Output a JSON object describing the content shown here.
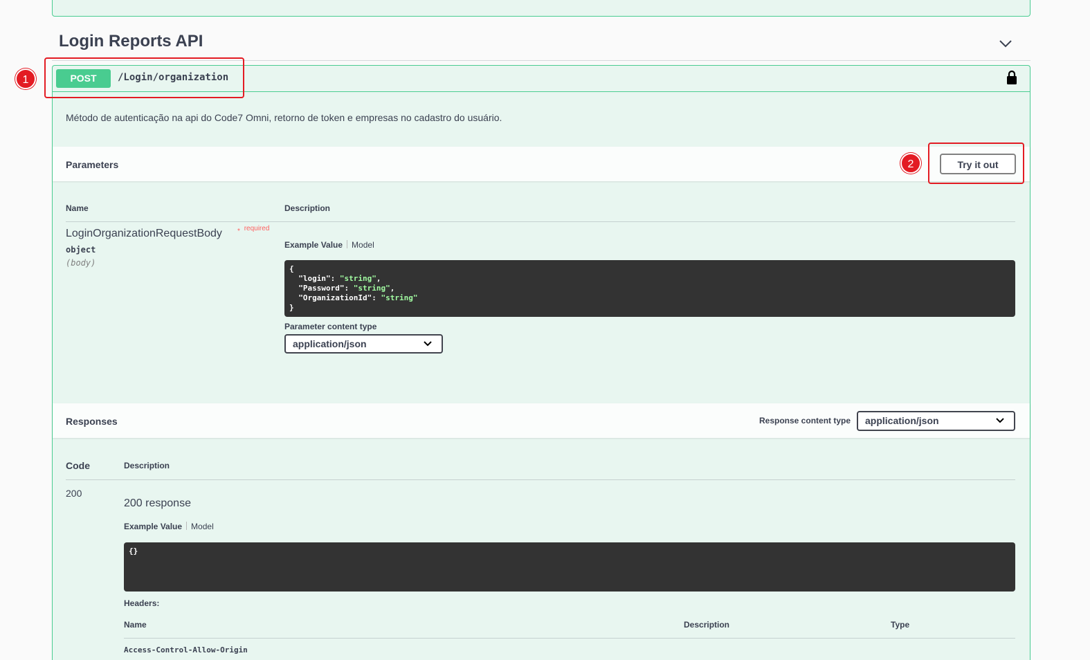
{
  "section": {
    "title": "Login Reports API"
  },
  "operation": {
    "method": "POST",
    "path": "/Login/organization",
    "description": "Método de autenticação na api do Code7 Omni, retorno de token e empresas no cadastro do usuário."
  },
  "parameters": {
    "title": "Parameters",
    "try_it_out_label": "Try it out",
    "col_name": "Name",
    "col_description": "Description",
    "param": {
      "name": "LoginOrganizationRequestBody",
      "required_mark": "*",
      "required_label": "required",
      "type": "object",
      "in": "(body)"
    },
    "tab_example": "Example Value",
    "tab_model": "Model",
    "example_lines": [
      {
        "open": "{"
      },
      {
        "key": "\"login\"",
        "value": "\"string\"",
        "sep": ","
      },
      {
        "key": "\"Password\"",
        "value": "\"string\"",
        "sep": ","
      },
      {
        "key": "\"OrganizationId\"",
        "value": "\"string\"",
        "sep": ""
      },
      {
        "close": "}"
      }
    ],
    "content_type_label": "Parameter content type",
    "content_type_value": "application/json"
  },
  "responses": {
    "title": "Responses",
    "content_type_label": "Response content type",
    "content_type_value": "application/json",
    "col_code": "Code",
    "col_description": "Description",
    "rows": [
      {
        "code": "200",
        "description": "200 response",
        "tab_example": "Example Value",
        "tab_model": "Model",
        "example": "{}",
        "headers_label": "Headers:",
        "headers_cols": {
          "name": "Name",
          "description": "Description",
          "type": "Type"
        },
        "headers_first": "Access-Control-Allow-Origin"
      }
    ]
  },
  "annotations": {
    "badge1": "1",
    "badge2": "2"
  },
  "colors": {
    "post": "#49cc90",
    "post_bg": "#e8f6f0",
    "annotation": "#e31b23",
    "code_bg": "#333333"
  },
  "icons": {
    "collapse": "chevron-down-icon",
    "auth": "lock-icon",
    "select": "chevron-down-icon"
  }
}
